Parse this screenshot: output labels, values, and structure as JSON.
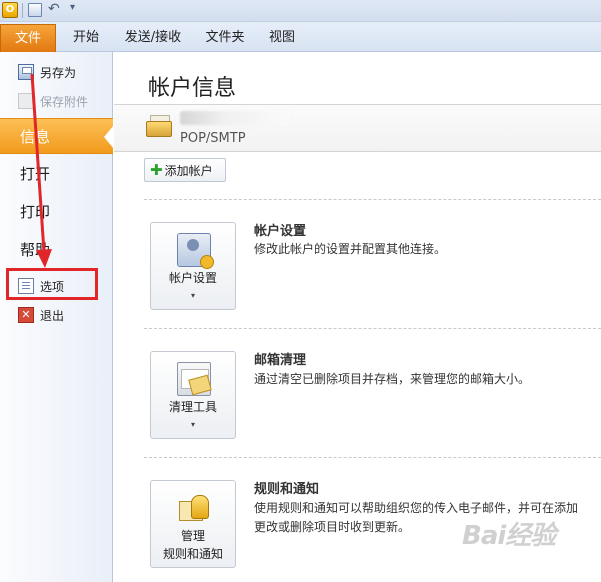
{
  "quick_access": {
    "logo_text": "O",
    "icons": [
      "outlook-logo-icon",
      "save-icon",
      "undo-icon",
      "customize-icon"
    ],
    "undo_glyph": "↶",
    "more_glyph": "▾"
  },
  "tabs": {
    "file": "文件",
    "home": "开始",
    "send_receive": "发送/接收",
    "folder": "文件夹",
    "view": "视图"
  },
  "nav": {
    "save_as": "另存为",
    "save_attachments": "保存附件",
    "info": "信息",
    "open": "打开",
    "print": "打印",
    "help": "帮助",
    "options": "选项",
    "exit": "退出",
    "exit_glyph": "✕"
  },
  "main": {
    "title": "帐户信息",
    "account_type": "POP/SMTP",
    "add_account": "添加帐户",
    "plus_glyph": "✚",
    "sections": [
      {
        "button_label": "帐户设置",
        "title": "帐户设置",
        "description": "修改此帐户的设置并配置其他连接。"
      },
      {
        "button_label": "清理工具",
        "title": "邮箱清理",
        "description": "通过清空已删除项目并存档，来管理您的邮箱大小。"
      },
      {
        "button_label_line1": "管理",
        "button_label_line2": "规则和通知",
        "title": "规则和通知",
        "description_line1": "使用规则和通知可以帮助组织您的传入电子邮件，并可在添加",
        "description_line2": "更改或删除项目时收到更新。"
      }
    ],
    "caret_glyph": "▾"
  },
  "annotation": {
    "color": "#e1262a"
  },
  "watermark": "Bai经验"
}
